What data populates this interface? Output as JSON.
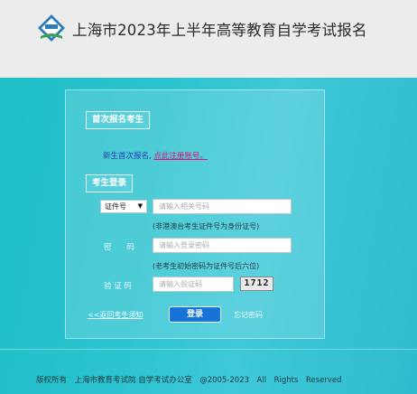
{
  "header": {
    "logo_icon": "shanghai-exam-logo-icon",
    "title": "上海市2023年上半年高等教育自学考试报名"
  },
  "first_time": {
    "section_title": "首次报名考生",
    "note": "新生首次报名,",
    "register_link": "点此注册账号。"
  },
  "login": {
    "section_title": "考生登录",
    "id_type": {
      "selected": "证件号",
      "caret_icon": "dropdown-caret-icon"
    },
    "id_placeholder": "请输入相关号码",
    "id_hint": "(非港澳台考生证件号为身份证号)",
    "password_label": "密　　码",
    "password_placeholder": "请输入登录密码",
    "password_hint": "(老考生初始密码为证件号后六位)",
    "captcha_label": "验 证 码",
    "captcha_placeholder": "请输入验证码",
    "captcha_text": "1712",
    "back_link": "<<返回考生须知",
    "login_button": "登录",
    "forgot_password": "忘记密码"
  },
  "footer": {
    "text": "版权所有　上海市教育考试院 自学考试办公室　@2005-2023　All　Rights　Reserved"
  },
  "colors": {
    "accent": "#1773d6",
    "register_link": "#e0127a",
    "background": "#2bc3cf"
  }
}
